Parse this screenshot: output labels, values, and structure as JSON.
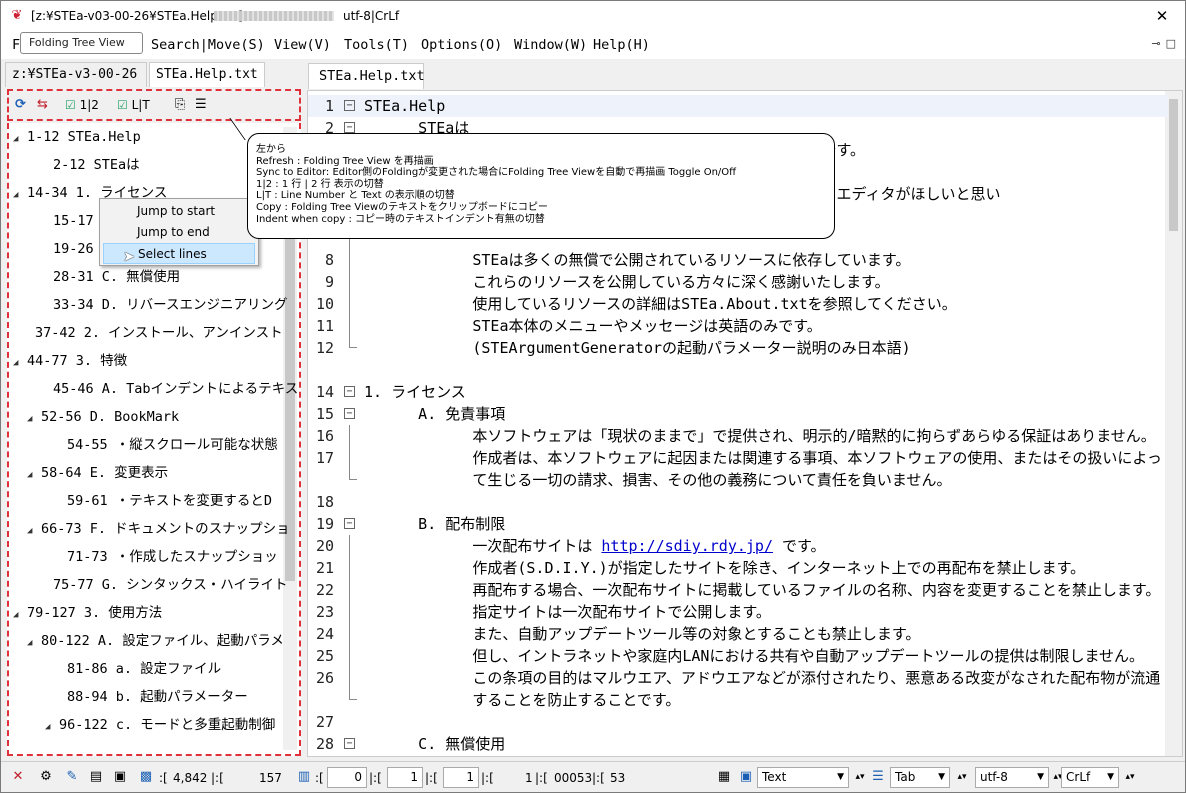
{
  "window": {
    "title": "[z:¥STEa-v03-00-26¥STEa.Help.txt]",
    "encoding_title": "utf-8|CrLf",
    "close_label": "✕"
  },
  "menu": [
    "F",
    "Search|Move(S)",
    "View(V)",
    "Tools(T)",
    "Options(O)",
    "Window(W)",
    "Help(H)"
  ],
  "tooltip": "Folding Tree View",
  "left_tabs": [
    "z:¥STEa-v3-00-26",
    "STEa.Help.txt"
  ],
  "tree_toolbar": {
    "refresh": "⟳",
    "sync": "⇆",
    "one_two": "1|2",
    "line_text": "L|T",
    "copy": "⎘",
    "indent": "☰"
  },
  "tree": [
    {
      "label": "1-12  STEa.Help",
      "expander": "◢"
    },
    {
      "label": "2-12  STEaは",
      "expander": ""
    },
    {
      "label": "14-34  1. ライセンス",
      "expander": "◢"
    },
    {
      "label": "15-17  A",
      "expander": ""
    },
    {
      "label": "19-26  B",
      "expander": ""
    },
    {
      "label": "28-31  C. 無償使用",
      "expander": ""
    },
    {
      "label": "33-34  D. リバースエンジニアリング",
      "expander": ""
    },
    {
      "label": "37-42  2. インストール、アンインスト",
      "expander": ""
    },
    {
      "label": "44-77  3. 特徴",
      "expander": "◢"
    },
    {
      "label": "45-46  A. Tabインデントによるテキス",
      "expander": ""
    },
    {
      "label": "52-56  D. BookMark",
      "expander": "◢"
    },
    {
      "label": "54-55  ・縦スクロール可能な状態",
      "expander": ""
    },
    {
      "label": "58-64  E. 変更表示",
      "expander": "◢"
    },
    {
      "label": "59-61  ・テキストを変更するとD",
      "expander": ""
    },
    {
      "label": "66-73  F. ドキュメントのスナップショ",
      "expander": "◢"
    },
    {
      "label": "71-73  ・作成したスナップショッ",
      "expander": ""
    },
    {
      "label": "75-77  G. シンタックス・ハイライト",
      "expander": ""
    },
    {
      "label": "79-127  3. 使用方法",
      "expander": "◢"
    },
    {
      "label": "80-122  A. 設定ファイル、起動パラメ",
      "expander": "◢"
    },
    {
      "label": "81-86  a. 設定ファイル",
      "expander": ""
    },
    {
      "label": "88-94  b. 起動パラメーター",
      "expander": ""
    },
    {
      "label": "96-122  c. モードと多重起動制御",
      "expander": "◢"
    }
  ],
  "context_menu": [
    "Jump to start",
    "Jump to end",
    "Select lines"
  ],
  "annotation": [
    "左から",
    "Refresh : Folding Tree View を再描画",
    "Sync to Editor: Editor側のFoldingが変更された場合にFolding Tree Viewを自動で再描画 Toggle On/Off",
    "1|2 : 1 行 | 2 行 表示の切替",
    "L|T : Line Number と Text の表示順の切替",
    "Copy : Folding Tree Viewのテキストをクリップボードにコピー",
    "Indent when copy : コピー時のテキストインデント有無の切替"
  ],
  "editor_tab": "STEa.Help.txt",
  "editor_lines": [
    {
      "n": "1",
      "fold": "box",
      "text": "STEa.Help"
    },
    {
      "n": "2",
      "fold": "box",
      "text": "      STEaは"
    },
    {
      "n": "",
      "fold": "line",
      "text": "                                                 格です。"
    },
    {
      "n": "",
      "fold": "line",
      "text": ""
    },
    {
      "n": "",
      "fold": "line",
      "text": "                                                 ストエディタがほしいと思い"
    },
    {
      "n": "",
      "fold": "line",
      "text": ""
    },
    {
      "n": "",
      "fold": "line",
      "text": ""
    },
    {
      "n": "8",
      "fold": "line",
      "text": "            STEaは多くの無償で公開されているリソースに依存しています。"
    },
    {
      "n": "9",
      "fold": "line",
      "text": "            これらのリソースを公開している方々に深く感謝いたします。"
    },
    {
      "n": "10",
      "fold": "line",
      "text": "            使用しているリソースの詳細はSTEa.About.txtを参照してください。"
    },
    {
      "n": "11",
      "fold": "line",
      "text": "            STEa本体のメニューやメッセージは英語のみです。"
    },
    {
      "n": "12",
      "fold": "end",
      "text": "            (STEArgumentGeneratorの起動パラメーター説明のみ日本語)"
    },
    {
      "n": "",
      "fold": "",
      "text": ""
    },
    {
      "n": "14",
      "fold": "box",
      "text": "1. ライセンス"
    },
    {
      "n": "15",
      "fold": "box",
      "text": "      A. 免責事項"
    },
    {
      "n": "16",
      "fold": "line",
      "text": "            本ソフトウェアは「現状のままで」で提供され、明示的/暗黙的に拘らずあらゆる保証はありません。"
    },
    {
      "n": "17",
      "fold": "line",
      "text": "            作成者は、本ソフトウェアに起因または関連する事項、本ソフトウェアの使用、またはその扱いによっ"
    },
    {
      "n": "",
      "fold": "end",
      "text": "            て生じる一切の請求、損害、その他の義務について責任を負いません。"
    },
    {
      "n": "18",
      "fold": "",
      "text": ""
    },
    {
      "n": "19",
      "fold": "box",
      "text": "      B. 配布制限"
    },
    {
      "n": "20",
      "fold": "line",
      "text": "            一次配布サイトは http://sdiy.rdy.jp/ です。"
    },
    {
      "n": "21",
      "fold": "line",
      "text": "            作成者(S.D.I.Y.)が指定したサイトを除き、インターネット上での再配布を禁止します。"
    },
    {
      "n": "22",
      "fold": "line",
      "text": "            再配布する場合、一次配布サイトに掲載しているファイルの名称、内容を変更することを禁止します。"
    },
    {
      "n": "23",
      "fold": "line",
      "text": "            指定サイトは一次配布サイトで公開します。"
    },
    {
      "n": "24",
      "fold": "line",
      "text": "            また、自動アップデートツール等の対象とすることも禁止します。"
    },
    {
      "n": "25",
      "fold": "line",
      "text": "            但し、イントラネットや家庭内LANにおける共有や自動アップデートツールの提供は制限しません。"
    },
    {
      "n": "26",
      "fold": "line",
      "text": "            この条項の目的はマルウエア、アドウエアなどが添付されたり、悪意ある改変がなされた配布物が流通"
    },
    {
      "n": "",
      "fold": "end",
      "text": "            することを防止することです。"
    },
    {
      "n": "27",
      "fold": "",
      "text": ""
    },
    {
      "n": "28",
      "fold": "box",
      "text": "      C. 無償使用"
    }
  ],
  "editor_link": {
    "before": "            一次配布サイトは ",
    "url": "http://sdiy.rdy.jp/",
    "after": " です。"
  },
  "status": {
    "close": "✕",
    "line_total": "4,842",
    "col": "157",
    "v1": "0",
    "v2": "1",
    "v3": "1",
    "v4": "1",
    "code": "00053",
    "code2": "53",
    "mode": "Text",
    "indent": "Tab",
    "encoding": "utf-8",
    "newline": "CrLf"
  },
  "colors": {
    "highlight": "#e0303a",
    "link": "#0000cc",
    "menu_hover": "#cce8ff"
  }
}
